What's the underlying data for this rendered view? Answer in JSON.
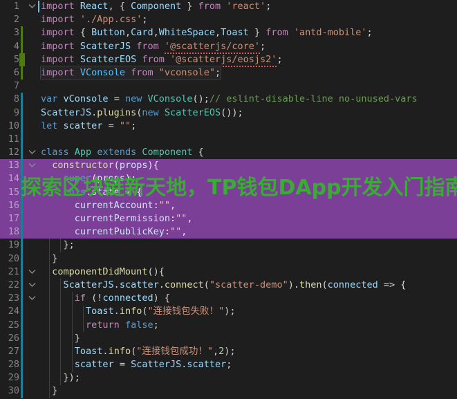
{
  "editor": {
    "app": "code-editor",
    "language": "javascript",
    "theme_background": "#1e1e1e",
    "selection_color": "#7b3f98",
    "gutter_added_color": "#4e7a0e",
    "gutter_cursor_color": "#1a7f94",
    "caret_color": "#4ec9f0",
    "watermark": {
      "text": "探索区块链新天地，TP钱包DApp开发入门指南",
      "color": "#3aab35"
    },
    "lines": [
      {
        "n": "1",
        "fold": "chevron-down-icon",
        "change": "none",
        "caret": true,
        "indent": 0,
        "tokens": [
          {
            "t": "import",
            "c": "kw"
          },
          {
            "t": " ",
            "c": "op"
          },
          {
            "t": "React",
            "c": "var"
          },
          {
            "t": ", { ",
            "c": "op"
          },
          {
            "t": "Component",
            "c": "var"
          },
          {
            "t": " } ",
            "c": "op"
          },
          {
            "t": "from",
            "c": "kw"
          },
          {
            "t": " ",
            "c": "op"
          },
          {
            "t": "'react'",
            "c": "str"
          },
          {
            "t": ";",
            "c": "op"
          }
        ]
      },
      {
        "n": "2",
        "fold": "",
        "change": "none",
        "indent": 0,
        "tokens": [
          {
            "t": "import",
            "c": "kw"
          },
          {
            "t": " ",
            "c": "op"
          },
          {
            "t": "'./App.css'",
            "c": "str"
          },
          {
            "t": ";",
            "c": "op"
          }
        ]
      },
      {
        "n": "3",
        "fold": "",
        "change": "added",
        "indent": 0,
        "tokens": [
          {
            "t": "import",
            "c": "kw"
          },
          {
            "t": " { ",
            "c": "op"
          },
          {
            "t": "Button",
            "c": "var"
          },
          {
            "t": ",",
            "c": "op"
          },
          {
            "t": "Card",
            "c": "var"
          },
          {
            "t": ",",
            "c": "op"
          },
          {
            "t": "WhiteSpace",
            "c": "var"
          },
          {
            "t": ",",
            "c": "op"
          },
          {
            "t": "Toast",
            "c": "var"
          },
          {
            "t": " } ",
            "c": "op"
          },
          {
            "t": "from",
            "c": "kw"
          },
          {
            "t": " ",
            "c": "op"
          },
          {
            "t": "'antd-mobile'",
            "c": "str"
          },
          {
            "t": ";",
            "c": "op"
          }
        ]
      },
      {
        "n": "4",
        "fold": "",
        "change": "added",
        "indent": 0,
        "tokens": [
          {
            "t": "import",
            "c": "kw"
          },
          {
            "t": " ",
            "c": "op"
          },
          {
            "t": "ScatterJS",
            "c": "var"
          },
          {
            "t": " ",
            "c": "op"
          },
          {
            "t": "from",
            "c": "kw"
          },
          {
            "t": " ",
            "c": "op"
          },
          {
            "t": "'@scatterjs/core'",
            "c": "str squiggle"
          },
          {
            "t": ";",
            "c": "op"
          }
        ]
      },
      {
        "n": "5",
        "fold": "",
        "change": "added-wide",
        "indent": 0,
        "tokens": [
          {
            "t": "import",
            "c": "kw"
          },
          {
            "t": " ",
            "c": "op"
          },
          {
            "t": "ScatterEOS",
            "c": "var"
          },
          {
            "t": " ",
            "c": "op"
          },
          {
            "t": "from",
            "c": "kw"
          },
          {
            "t": " ",
            "c": "op"
          },
          {
            "t": "'@scatterjs/eosjs2'",
            "c": "str squiggle"
          },
          {
            "t": ";",
            "c": "op"
          }
        ]
      },
      {
        "n": "6",
        "fold": "",
        "change": "added",
        "indent": 0,
        "boxed": true,
        "tokens": [
          {
            "t": "import",
            "c": "kw"
          },
          {
            "t": " ",
            "c": "op"
          },
          {
            "t": "VConsole",
            "c": "cls"
          },
          {
            "t": " ",
            "c": "op"
          },
          {
            "t": "from",
            "c": "kw"
          },
          {
            "t": " ",
            "c": "op"
          },
          {
            "t": "\"vconsole\"",
            "c": "str"
          },
          {
            "t": ";",
            "c": "op"
          }
        ]
      },
      {
        "n": "7",
        "fold": "",
        "change": "none",
        "indent": 0,
        "tokens": []
      },
      {
        "n": "8",
        "fold": "",
        "change": "cursor",
        "indent": 0,
        "tokens": [
          {
            "t": "var",
            "c": "kw2"
          },
          {
            "t": " ",
            "c": "op"
          },
          {
            "t": "vConsole",
            "c": "var"
          },
          {
            "t": " = ",
            "c": "op"
          },
          {
            "t": "new",
            "c": "kw2"
          },
          {
            "t": " ",
            "c": "op"
          },
          {
            "t": "VConsole",
            "c": "typ"
          },
          {
            "t": "();",
            "c": "op"
          },
          {
            "t": "// eslint-disable-line no-unused-vars",
            "c": "cmt"
          }
        ]
      },
      {
        "n": "9",
        "fold": "",
        "change": "cursor",
        "indent": 0,
        "tokens": [
          {
            "t": "ScatterJS",
            "c": "var"
          },
          {
            "t": ".",
            "c": "op"
          },
          {
            "t": "plugins",
            "c": "fn"
          },
          {
            "t": "(",
            "c": "op"
          },
          {
            "t": "new",
            "c": "kw2"
          },
          {
            "t": " ",
            "c": "op"
          },
          {
            "t": "ScatterEOS",
            "c": "typ"
          },
          {
            "t": "());",
            "c": "op"
          }
        ]
      },
      {
        "n": "10",
        "fold": "",
        "change": "cursor",
        "indent": 0,
        "tokens": [
          {
            "t": "let",
            "c": "kw2"
          },
          {
            "t": " ",
            "c": "op"
          },
          {
            "t": "scatter",
            "c": "var"
          },
          {
            "t": " = ",
            "c": "op"
          },
          {
            "t": "\"\"",
            "c": "str"
          },
          {
            "t": ";",
            "c": "op"
          }
        ]
      },
      {
        "n": "11",
        "fold": "",
        "change": "cursor",
        "indent": 0,
        "tokens": []
      },
      {
        "n": "12",
        "fold": "chevron-down-icon",
        "change": "cursor",
        "indent": 0,
        "tokens": [
          {
            "t": "class",
            "c": "kw2"
          },
          {
            "t": " ",
            "c": "op"
          },
          {
            "t": "App",
            "c": "typ"
          },
          {
            "t": " ",
            "c": "op"
          },
          {
            "t": "extends",
            "c": "kw2"
          },
          {
            "t": " ",
            "c": "op"
          },
          {
            "t": "Component",
            "c": "typ"
          },
          {
            "t": " {",
            "c": "op"
          }
        ]
      },
      {
        "n": "13",
        "fold": "chevron-down-icon",
        "change": "cursor",
        "selected": true,
        "indent": 1,
        "tokens": [
          {
            "t": "  ",
            "c": "op"
          },
          {
            "t": "constructor",
            "c": "fn"
          },
          {
            "t": "(",
            "c": "op"
          },
          {
            "t": "props",
            "c": "var"
          },
          {
            "t": "){",
            "c": "op"
          }
        ]
      },
      {
        "n": "14",
        "fold": "",
        "change": "cursor",
        "selected": true,
        "indent": 2,
        "tokens": [
          {
            "t": "    ",
            "c": "op"
          },
          {
            "t": "super",
            "c": "kw2"
          },
          {
            "t": "(",
            "c": "op"
          },
          {
            "t": "props",
            "c": "var"
          },
          {
            "t": ");",
            "c": "op"
          }
        ]
      },
      {
        "n": "15",
        "fold": "",
        "change": "cursor",
        "selected": true,
        "indent": 2,
        "tokens": [
          {
            "t": "    ",
            "c": "op"
          },
          {
            "t": "this",
            "c": "kw2"
          },
          {
            "t": ".",
            "c": "op"
          },
          {
            "t": "state",
            "c": "var"
          },
          {
            "t": " = {",
            "c": "op"
          }
        ]
      },
      {
        "n": "16",
        "fold": "",
        "change": "cursor",
        "selected": true,
        "indent": 3,
        "tokens": [
          {
            "t": "      ",
            "c": "op"
          },
          {
            "t": "currentAccount",
            "c": "var"
          },
          {
            "t": ":",
            "c": "op"
          },
          {
            "t": "\"\"",
            "c": "str"
          },
          {
            "t": ",",
            "c": "op"
          }
        ]
      },
      {
        "n": "17",
        "fold": "",
        "change": "cursor",
        "selected": true,
        "indent": 3,
        "tokens": [
          {
            "t": "      ",
            "c": "op"
          },
          {
            "t": "currentPermission",
            "c": "var"
          },
          {
            "t": ":",
            "c": "op"
          },
          {
            "t": "\"\"",
            "c": "str"
          },
          {
            "t": ",",
            "c": "op"
          }
        ]
      },
      {
        "n": "18",
        "fold": "",
        "change": "cursor",
        "selected": true,
        "indent": 3,
        "tokens": [
          {
            "t": "      ",
            "c": "op"
          },
          {
            "t": "currentPublicKey",
            "c": "var"
          },
          {
            "t": ":",
            "c": "op"
          },
          {
            "t": "\"\"",
            "c": "str"
          },
          {
            "t": ",",
            "c": "op"
          }
        ]
      },
      {
        "n": "19",
        "fold": "",
        "change": "cursor",
        "indent": 2,
        "tokens": [
          {
            "t": "    };",
            "c": "op"
          }
        ]
      },
      {
        "n": "20",
        "fold": "",
        "change": "cursor",
        "indent": 1,
        "tokens": [
          {
            "t": "  }",
            "c": "op"
          }
        ]
      },
      {
        "n": "21",
        "fold": "chevron-down-icon",
        "change": "cursor",
        "indent": 1,
        "tokens": [
          {
            "t": "  ",
            "c": "op"
          },
          {
            "t": "componentDidMount",
            "c": "fn"
          },
          {
            "t": "(){",
            "c": "op"
          }
        ]
      },
      {
        "n": "22",
        "fold": "chevron-down-icon",
        "change": "cursor",
        "indent": 2,
        "tokens": [
          {
            "t": "    ",
            "c": "op"
          },
          {
            "t": "ScatterJS",
            "c": "var"
          },
          {
            "t": ".",
            "c": "op"
          },
          {
            "t": "scatter",
            "c": "var"
          },
          {
            "t": ".",
            "c": "op"
          },
          {
            "t": "connect",
            "c": "fn"
          },
          {
            "t": "(",
            "c": "op"
          },
          {
            "t": "\"scatter-demo\"",
            "c": "str"
          },
          {
            "t": ").",
            "c": "op"
          },
          {
            "t": "then",
            "c": "fn"
          },
          {
            "t": "(",
            "c": "op"
          },
          {
            "t": "connected",
            "c": "var"
          },
          {
            "t": " => {",
            "c": "op"
          }
        ]
      },
      {
        "n": "23",
        "fold": "chevron-down-icon",
        "change": "cursor",
        "indent": 3,
        "tokens": [
          {
            "t": "      ",
            "c": "op"
          },
          {
            "t": "if",
            "c": "kw"
          },
          {
            "t": " (!",
            "c": "op"
          },
          {
            "t": "connected",
            "c": "var"
          },
          {
            "t": ") {",
            "c": "op"
          }
        ]
      },
      {
        "n": "24",
        "fold": "",
        "change": "cursor",
        "indent": 4,
        "tokens": [
          {
            "t": "        ",
            "c": "op"
          },
          {
            "t": "Toast",
            "c": "var"
          },
          {
            "t": ".",
            "c": "op"
          },
          {
            "t": "info",
            "c": "fn"
          },
          {
            "t": "(",
            "c": "op"
          },
          {
            "t": "\"连接钱包失败！\"",
            "c": "str"
          },
          {
            "t": ");",
            "c": "op"
          }
        ]
      },
      {
        "n": "25",
        "fold": "",
        "change": "cursor",
        "indent": 4,
        "tokens": [
          {
            "t": "        ",
            "c": "op"
          },
          {
            "t": "return",
            "c": "kw"
          },
          {
            "t": " ",
            "c": "op"
          },
          {
            "t": "false",
            "c": "kw2"
          },
          {
            "t": ";",
            "c": "op"
          }
        ]
      },
      {
        "n": "26",
        "fold": "",
        "change": "cursor",
        "indent": 3,
        "tokens": [
          {
            "t": "      }",
            "c": "op"
          }
        ]
      },
      {
        "n": "27",
        "fold": "",
        "change": "cursor",
        "indent": 3,
        "tokens": [
          {
            "t": "      ",
            "c": "op"
          },
          {
            "t": "Toast",
            "c": "var"
          },
          {
            "t": ".",
            "c": "op"
          },
          {
            "t": "info",
            "c": "fn"
          },
          {
            "t": "(",
            "c": "op"
          },
          {
            "t": "\"连接钱包成功！\"",
            "c": "str"
          },
          {
            "t": ",",
            "c": "op"
          },
          {
            "t": "2",
            "c": "num"
          },
          {
            "t": ");",
            "c": "op"
          }
        ]
      },
      {
        "n": "28",
        "fold": "",
        "change": "cursor",
        "indent": 3,
        "tokens": [
          {
            "t": "      ",
            "c": "op"
          },
          {
            "t": "scatter",
            "c": "var"
          },
          {
            "t": " = ",
            "c": "op"
          },
          {
            "t": "ScatterJS",
            "c": "var"
          },
          {
            "t": ".",
            "c": "op"
          },
          {
            "t": "scatter",
            "c": "var"
          },
          {
            "t": ";",
            "c": "op"
          }
        ]
      },
      {
        "n": "29",
        "fold": "",
        "change": "cursor",
        "indent": 2,
        "tokens": [
          {
            "t": "    });",
            "c": "op"
          }
        ]
      },
      {
        "n": "30",
        "fold": "",
        "change": "cursor",
        "indent": 1,
        "tokens": [
          {
            "t": "  }",
            "c": "op"
          }
        ]
      }
    ]
  }
}
